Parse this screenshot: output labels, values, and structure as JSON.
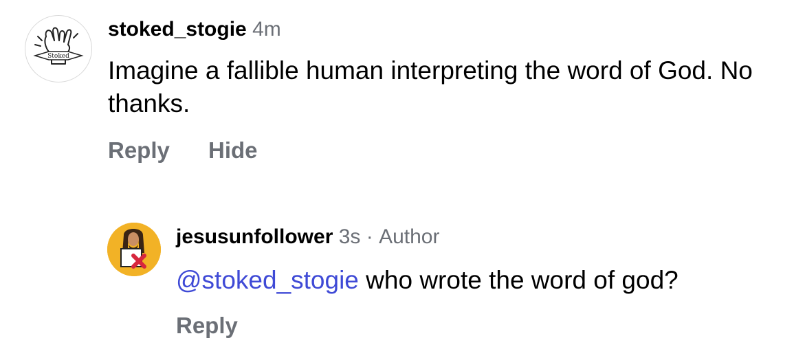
{
  "comments": [
    {
      "username": "stoked_stogie",
      "time": "4m",
      "text": "Imagine a fallible human interpreting the word of God. No thanks.",
      "actions": {
        "reply": "Reply",
        "hide": "Hide"
      },
      "avatar": {
        "icon": "shaka-hand-logo-icon",
        "logo_text": "Stoked"
      }
    },
    {
      "username": "jesusunfollower",
      "time": "3s",
      "separator": "·",
      "badge": "Author",
      "mention": "@stoked_stogie",
      "text": " who wrote the word of god?",
      "actions": {
        "reply": "Reply"
      },
      "avatar": {
        "icon": "jesus-unfollow-avatar-icon",
        "background": "#f2b226"
      }
    }
  ],
  "colors": {
    "text": "#000000",
    "meta": "#6b6f76",
    "mention": "#3f4ad6",
    "avatar_bg": "#f2b226",
    "x_mark": "#d7263d"
  }
}
